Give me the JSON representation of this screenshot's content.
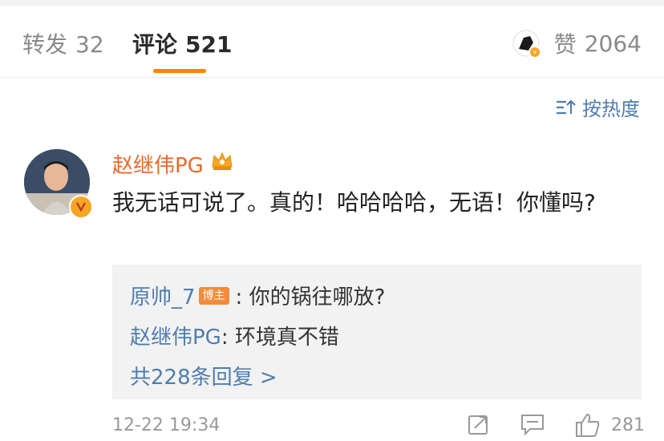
{
  "tabs": {
    "repost": {
      "label": "转发",
      "count": "32"
    },
    "comment": {
      "label": "评论",
      "count": "521"
    },
    "like": {
      "label": "赞",
      "count": "2064"
    }
  },
  "sort": {
    "label": "按热度"
  },
  "comment": {
    "username": "赵继伟PG",
    "text": "我无话可说了。真的！哈哈哈哈，无语！你懂吗?",
    "time": "12-22 19:34",
    "like_count": "281"
  },
  "replies": [
    {
      "name": "原帅_7",
      "badge": "博主",
      "text": ": 你的锅往哪放?"
    },
    {
      "name": "赵继伟PG",
      "text": ": 环境真不错"
    }
  ],
  "more_replies": "共228条回复 >",
  "colors": {
    "accent": "#ff8200",
    "link": "#507daf",
    "username": "#e86a2c"
  }
}
